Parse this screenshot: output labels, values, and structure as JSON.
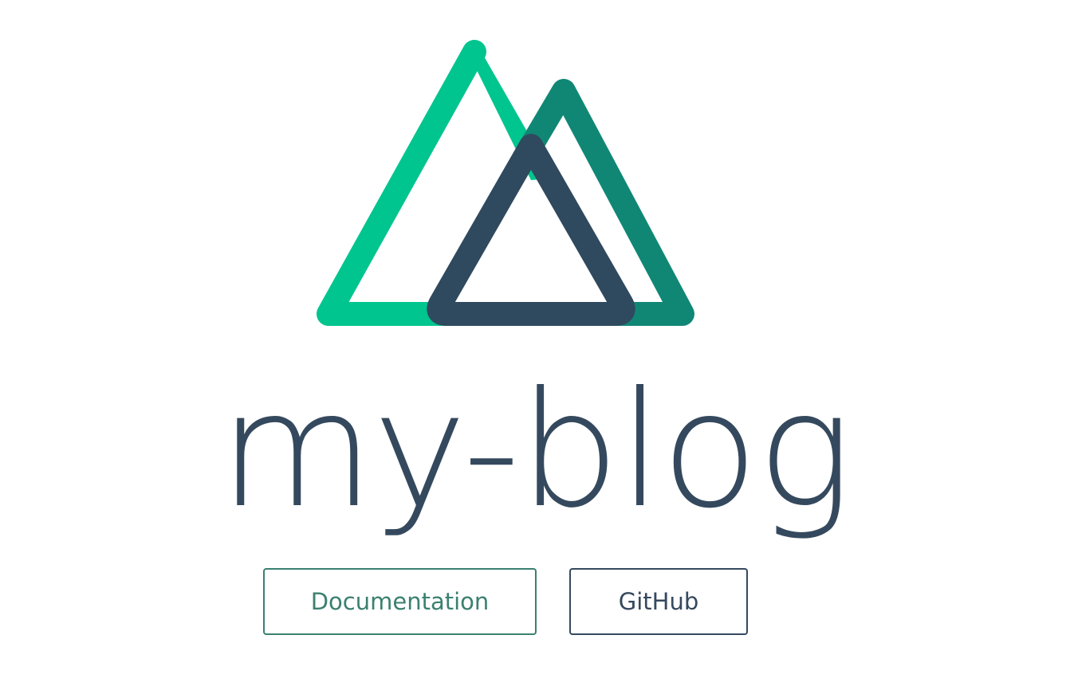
{
  "app": {
    "title": "my-blog"
  },
  "logo": {
    "icon": "nuxt-logo-icon",
    "colors": {
      "light_green": "#00C58E",
      "dark_green": "#108775",
      "navy": "#2F495E"
    }
  },
  "links": {
    "documentation_label": "Documentation",
    "github_label": "GitHub"
  },
  "colors": {
    "text": "#35495e",
    "accent": "#3b8070",
    "background": "#ffffff"
  }
}
